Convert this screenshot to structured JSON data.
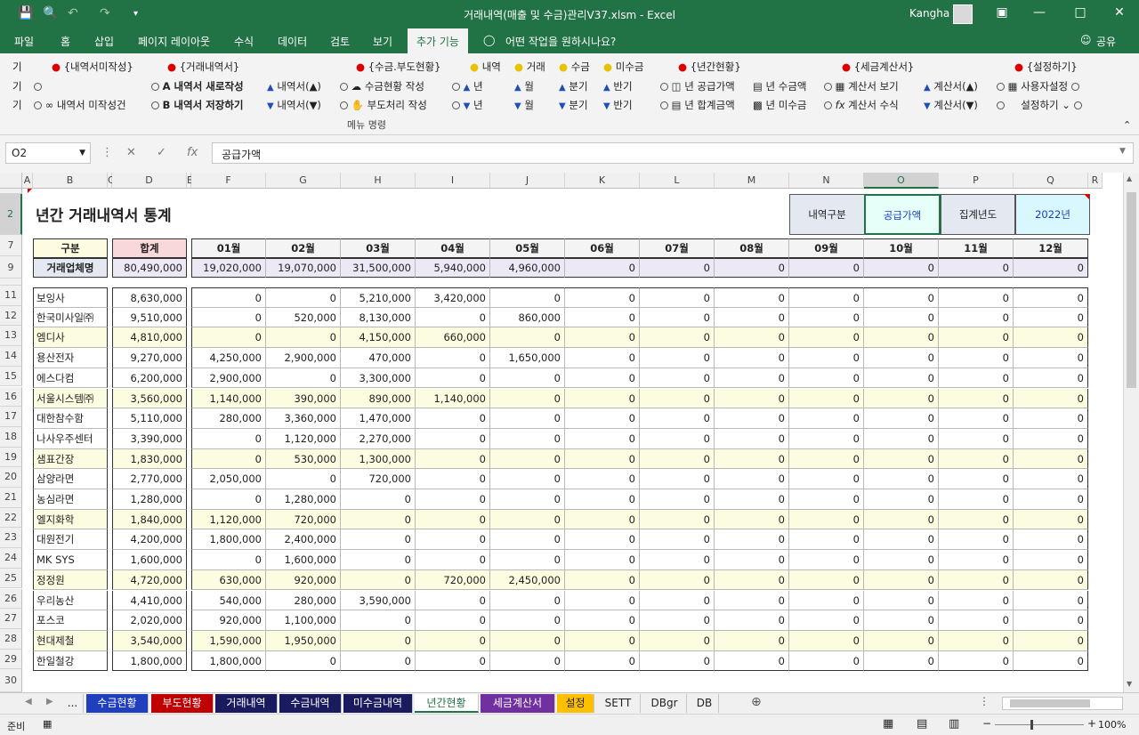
{
  "window": {
    "title": "거래내역(매출 및 수금)관리V37.xlsm  -  Excel",
    "user": "Kangha"
  },
  "ribbon_tabs": [
    "파일",
    "홈",
    "삽입",
    "페이지 레이아웃",
    "수식",
    "데이터",
    "검토",
    "보기",
    "추가 기능"
  ],
  "tell_me": "어떤 작업을 원하시나요?",
  "share": "공유",
  "ribbon": {
    "row1": [
      "{내역서미작성}",
      "{거래내역서}",
      "{수금.부도현황}",
      "내역",
      "거래",
      "수금",
      "미수금",
      "{년간현황}",
      "{세금계산서}",
      "{설정하기}"
    ],
    "row2": [
      "A 내역서 새로작성",
      "내역서(▲)",
      "수금현황 작성",
      "년",
      "월",
      "분기",
      "반기",
      "년 공급가액",
      "년 수금액",
      "계산서 보기",
      "계산서(▲)",
      "사용자설정"
    ],
    "row3": [
      "내역서 미작성건",
      "B 내역서 저장하기",
      "내역서(▼)",
      "부도처리 작성",
      "년",
      "월",
      "분기",
      "반기",
      "년 합계금액",
      "년 미수금",
      "계산서 수식",
      "계산서(▼)",
      "설정하기"
    ],
    "group_label": "메뉴 명령",
    "stub": "기"
  },
  "formula": {
    "namebox": "O2",
    "content": "공급가액"
  },
  "columns": [
    "A",
    "B",
    "C",
    "D",
    "E",
    "F",
    "G",
    "H",
    "I",
    "J",
    "K",
    "L",
    "M",
    "N",
    "O",
    "P",
    "Q",
    "R"
  ],
  "sheet": {
    "title": "년간 거래내역서 통계",
    "filter_label": "내역구분",
    "filter_value": "공급가액",
    "year_label": "집계년도",
    "year_value": "2022년",
    "header_category": "구분",
    "header_total": "합계",
    "months": [
      "01월",
      "02월",
      "03월",
      "04월",
      "05월",
      "06월",
      "07월",
      "08월",
      "09월",
      "10월",
      "11월",
      "12월"
    ],
    "summary_label": "거래업체명",
    "summary_total": "80,490,000",
    "summary_values": [
      "19,020,000",
      "19,070,000",
      "31,500,000",
      "5,940,000",
      "4,960,000",
      "0",
      "0",
      "0",
      "0",
      "0",
      "0",
      "0"
    ],
    "rows": [
      {
        "r": "11",
        "name": "보잉사",
        "total": "8,630,000",
        "v": [
          "0",
          "0",
          "5,210,000",
          "3,420,000",
          "0",
          "0",
          "0",
          "0",
          "0",
          "0",
          "0",
          "0"
        ]
      },
      {
        "r": "12",
        "name": "한국미사일㈜",
        "total": "9,510,000",
        "v": [
          "0",
          "520,000",
          "8,130,000",
          "0",
          "860,000",
          "0",
          "0",
          "0",
          "0",
          "0",
          "0",
          "0"
        ]
      },
      {
        "r": "13",
        "name": "엠디사",
        "total": "4,810,000",
        "v": [
          "0",
          "0",
          "4,150,000",
          "660,000",
          "0",
          "0",
          "0",
          "0",
          "0",
          "0",
          "0",
          "0"
        ]
      },
      {
        "r": "14",
        "name": "용산전자",
        "total": "9,270,000",
        "v": [
          "4,250,000",
          "2,900,000",
          "470,000",
          "0",
          "1,650,000",
          "0",
          "0",
          "0",
          "0",
          "0",
          "0",
          "0"
        ]
      },
      {
        "r": "15",
        "name": "에스다컴",
        "total": "6,200,000",
        "v": [
          "2,900,000",
          "0",
          "3,300,000",
          "0",
          "0",
          "0",
          "0",
          "0",
          "0",
          "0",
          "0",
          "0"
        ]
      },
      {
        "r": "16",
        "name": "서울시스템㈜",
        "total": "3,560,000",
        "v": [
          "1,140,000",
          "390,000",
          "890,000",
          "1,140,000",
          "0",
          "0",
          "0",
          "0",
          "0",
          "0",
          "0",
          "0"
        ]
      },
      {
        "r": "17",
        "name": "대한참수함",
        "total": "5,110,000",
        "v": [
          "280,000",
          "3,360,000",
          "1,470,000",
          "0",
          "0",
          "0",
          "0",
          "0",
          "0",
          "0",
          "0",
          "0"
        ]
      },
      {
        "r": "18",
        "name": "나사우주센터",
        "total": "3,390,000",
        "v": [
          "0",
          "1,120,000",
          "2,270,000",
          "0",
          "0",
          "0",
          "0",
          "0",
          "0",
          "0",
          "0",
          "0"
        ]
      },
      {
        "r": "19",
        "name": "샘표간장",
        "total": "1,830,000",
        "v": [
          "0",
          "530,000",
          "1,300,000",
          "0",
          "0",
          "0",
          "0",
          "0",
          "0",
          "0",
          "0",
          "0"
        ]
      },
      {
        "r": "20",
        "name": "삼양라면",
        "total": "2,770,000",
        "v": [
          "2,050,000",
          "0",
          "720,000",
          "0",
          "0",
          "0",
          "0",
          "0",
          "0",
          "0",
          "0",
          "0"
        ]
      },
      {
        "r": "21",
        "name": "농심라면",
        "total": "1,280,000",
        "v": [
          "0",
          "1,280,000",
          "0",
          "0",
          "0",
          "0",
          "0",
          "0",
          "0",
          "0",
          "0",
          "0"
        ]
      },
      {
        "r": "22",
        "name": "엘지화학",
        "total": "1,840,000",
        "v": [
          "1,120,000",
          "720,000",
          "0",
          "0",
          "0",
          "0",
          "0",
          "0",
          "0",
          "0",
          "0",
          "0"
        ]
      },
      {
        "r": "23",
        "name": "대원전기",
        "total": "4,200,000",
        "v": [
          "1,800,000",
          "2,400,000",
          "0",
          "0",
          "0",
          "0",
          "0",
          "0",
          "0",
          "0",
          "0",
          "0"
        ]
      },
      {
        "r": "24",
        "name": "MK SYS",
        "total": "1,600,000",
        "v": [
          "0",
          "1,600,000",
          "0",
          "0",
          "0",
          "0",
          "0",
          "0",
          "0",
          "0",
          "0",
          "0"
        ]
      },
      {
        "r": "25",
        "name": "정정원",
        "total": "4,720,000",
        "v": [
          "630,000",
          "920,000",
          "0",
          "720,000",
          "2,450,000",
          "0",
          "0",
          "0",
          "0",
          "0",
          "0",
          "0"
        ]
      },
      {
        "r": "26",
        "name": "우리농산",
        "total": "4,410,000",
        "v": [
          "540,000",
          "280,000",
          "3,590,000",
          "0",
          "0",
          "0",
          "0",
          "0",
          "0",
          "0",
          "0",
          "0"
        ]
      },
      {
        "r": "27",
        "name": "포스코",
        "total": "2,020,000",
        "v": [
          "920,000",
          "1,100,000",
          "0",
          "0",
          "0",
          "0",
          "0",
          "0",
          "0",
          "0",
          "0",
          "0"
        ]
      },
      {
        "r": "28",
        "name": "현대제철",
        "total": "3,540,000",
        "v": [
          "1,590,000",
          "1,950,000",
          "0",
          "0",
          "0",
          "0",
          "0",
          "0",
          "0",
          "0",
          "0",
          "0"
        ]
      },
      {
        "r": "29",
        "name": "한일철강",
        "total": "1,800,000",
        "v": [
          "1,800,000",
          "0",
          "0",
          "0",
          "0",
          "0",
          "0",
          "0",
          "0",
          "0",
          "0",
          "0"
        ]
      }
    ]
  },
  "sheet_tabs": [
    {
      "label": "...",
      "bg": "#f0f0f0",
      "fg": "#222"
    },
    {
      "label": "수금현황",
      "bg": "#1f3fbf",
      "fg": "#ffffff"
    },
    {
      "label": "부도현황",
      "bg": "#c00000",
      "fg": "#ffffff"
    },
    {
      "label": "거래내역",
      "bg": "#1a1a5e",
      "fg": "#ffffff"
    },
    {
      "label": "수금내역",
      "bg": "#1a1a5e",
      "fg": "#ffffff"
    },
    {
      "label": "미수금내역",
      "bg": "#1a1a5e",
      "fg": "#ffffff"
    },
    {
      "label": "년간현황",
      "bg": "#ffffff",
      "fg": "#217346"
    },
    {
      "label": "세금계산서",
      "bg": "#7030a0",
      "fg": "#ffffff"
    },
    {
      "label": "설정",
      "bg": "#ffc000",
      "fg": "#222222"
    },
    {
      "label": "SETT",
      "bg": "#f0f0f0",
      "fg": "#222222"
    },
    {
      "label": "DBgr",
      "bg": "#f0f0f0",
      "fg": "#222222"
    },
    {
      "label": "DB",
      "bg": "#f0f0f0",
      "fg": "#222222"
    }
  ],
  "status": {
    "ready": "준비",
    "zoom": "100%"
  },
  "colors": {
    "accent": "#217346",
    "highlight_row": "#fcfce0",
    "summary_bg": "#ede8f5",
    "total_header": "#f8d8d8",
    "category_header": "#fdfbe0",
    "filter_bg": "#e4e8f0",
    "selected_cell": "#e6fff8",
    "year_bg": "#d8f7ff"
  }
}
